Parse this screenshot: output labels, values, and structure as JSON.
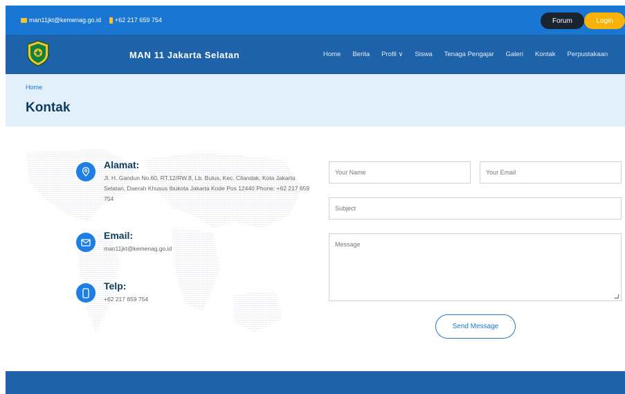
{
  "topbar": {
    "email": "man11jkt@kemenag.go.id",
    "phone": "+62 217 659 754",
    "forum_label": "Forum",
    "login_label": "Login"
  },
  "navbar": {
    "site_title": "MAN 11 Jakarta Selatan",
    "menu": [
      "Home",
      "Berita",
      "Profil ∨",
      "Siswa",
      "Tenaga Pengajar",
      "Galeri",
      "Kontak",
      "Perpustakaan"
    ]
  },
  "breadcrumb": {
    "home": "Home",
    "page_title": "Kontak"
  },
  "contact": {
    "address_heading": "Alamat:",
    "address_text": "Jl. H. Gandun No.60, RT.12/RW.8, Lb. Bulus, Kec. Cilandak, Kota Jakarta Selatan, Daerah Khusus Ibukota Jakarta Kode Pos 12440 Phone: +62 217 659 754",
    "email_heading": "Email:",
    "email_text": "man11jkt@kemenag.go.id",
    "phone_heading": "Telp:",
    "phone_text": "+62 217 659 754"
  },
  "form": {
    "name_placeholder": "Your Name",
    "email_placeholder": "Your Email",
    "subject_placeholder": "Subject",
    "message_placeholder": "Message",
    "send_label": "Send Message"
  },
  "colors": {
    "topbar": "#1976d2",
    "navbar": "#1e63aa",
    "accent_yellow": "#f9b208",
    "breadcrumb_bg": "#e2f0fb",
    "heading": "#0e3a5d"
  }
}
